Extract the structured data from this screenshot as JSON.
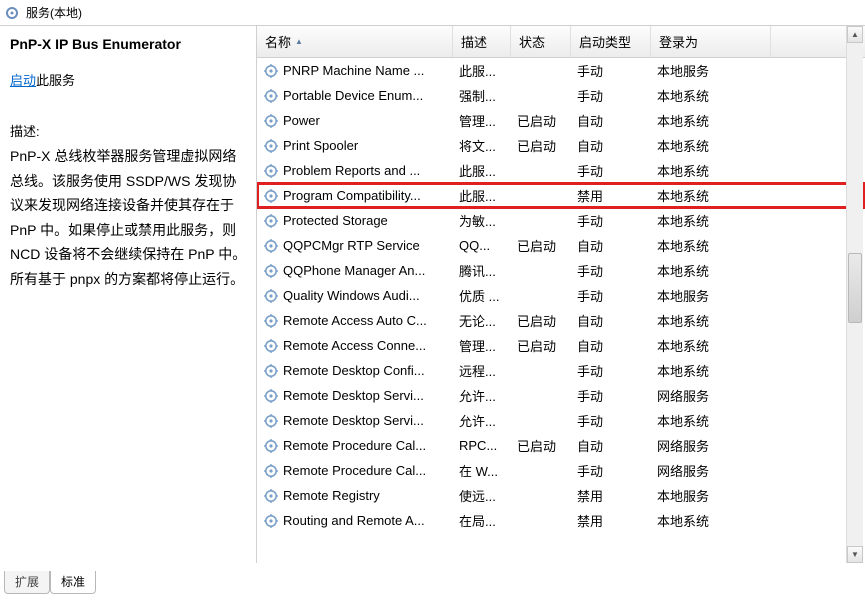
{
  "top": {
    "local_label": "服务(本地)"
  },
  "left": {
    "title": "PnP-X IP Bus Enumerator",
    "action_link": "启动",
    "action_rest": "此服务",
    "desc_label": "描述:",
    "desc_text": "PnP-X 总线枚举器服务管理虚拟网络总线。该服务使用 SSDP/WS 发现协议来发现网络连接设备并使其存在于 PnP 中。如果停止或禁用此服务，则 NCD 设备将不会继续保持在 PnP 中。所有基于 pnpx 的方案都将停止运行。"
  },
  "headers": {
    "name": "名称",
    "desc": "描述",
    "status": "状态",
    "start": "启动类型",
    "logon": "登录为"
  },
  "rows": [
    {
      "name": "PNRP Machine Name ...",
      "desc": "此服...",
      "status": "",
      "start": "手动",
      "logon": "本地服务"
    },
    {
      "name": "Portable Device Enum...",
      "desc": "强制...",
      "status": "",
      "start": "手动",
      "logon": "本地系统"
    },
    {
      "name": "Power",
      "desc": "管理...",
      "status": "已启动",
      "start": "自动",
      "logon": "本地系统"
    },
    {
      "name": "Print Spooler",
      "desc": "将文...",
      "status": "已启动",
      "start": "自动",
      "logon": "本地系统"
    },
    {
      "name": "Problem Reports and ...",
      "desc": "此服...",
      "status": "",
      "start": "手动",
      "logon": "本地系统"
    },
    {
      "name": "Program Compatibility...",
      "desc": "此服...",
      "status": "",
      "start": "禁用",
      "logon": "本地系统",
      "highlight": true
    },
    {
      "name": "Protected Storage",
      "desc": "为敏...",
      "status": "",
      "start": "手动",
      "logon": "本地系统"
    },
    {
      "name": "QQPCMgr RTP Service",
      "desc": "QQ...",
      "status": "已启动",
      "start": "自动",
      "logon": "本地系统"
    },
    {
      "name": "QQPhone Manager An...",
      "desc": "腾讯...",
      "status": "",
      "start": "手动",
      "logon": "本地系统"
    },
    {
      "name": "Quality Windows Audi...",
      "desc": "优质 ...",
      "status": "",
      "start": "手动",
      "logon": "本地服务"
    },
    {
      "name": "Remote Access Auto C...",
      "desc": "无论...",
      "status": "已启动",
      "start": "自动",
      "logon": "本地系统"
    },
    {
      "name": "Remote Access Conne...",
      "desc": "管理...",
      "status": "已启动",
      "start": "自动",
      "logon": "本地系统"
    },
    {
      "name": "Remote Desktop Confi...",
      "desc": "远程...",
      "status": "",
      "start": "手动",
      "logon": "本地系统"
    },
    {
      "name": "Remote Desktop Servi...",
      "desc": "允许...",
      "status": "",
      "start": "手动",
      "logon": "网络服务"
    },
    {
      "name": "Remote Desktop Servi...",
      "desc": "允许...",
      "status": "",
      "start": "手动",
      "logon": "本地系统"
    },
    {
      "name": "Remote Procedure Cal...",
      "desc": "RPC...",
      "status": "已启动",
      "start": "自动",
      "logon": "网络服务"
    },
    {
      "name": "Remote Procedure Cal...",
      "desc": "在 W...",
      "status": "",
      "start": "手动",
      "logon": "网络服务"
    },
    {
      "name": "Remote Registry",
      "desc": "使远...",
      "status": "",
      "start": "禁用",
      "logon": "本地服务"
    },
    {
      "name": "Routing and Remote A...",
      "desc": "在局...",
      "status": "",
      "start": "禁用",
      "logon": "本地系统"
    }
  ],
  "tabs": {
    "extended": "扩展",
    "standard": "标准"
  }
}
